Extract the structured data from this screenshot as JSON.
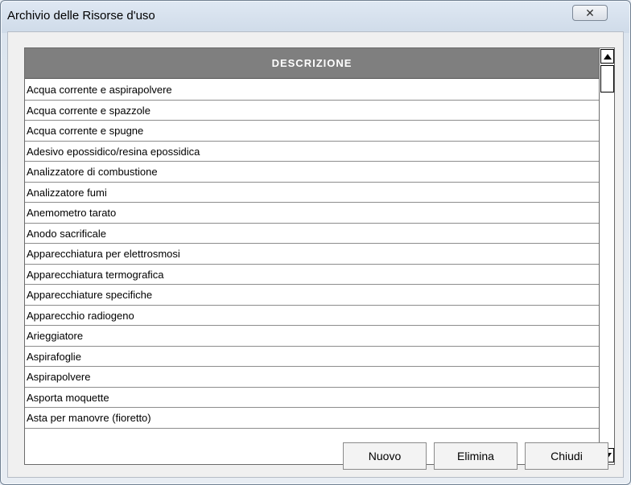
{
  "window": {
    "title": "Archivio delle Risorse d'uso",
    "close_glyph": "✕"
  },
  "grid": {
    "column_header": "DESCRIZIONE",
    "rows": [
      "Acqua corrente e aspirapolvere",
      "Acqua corrente e spazzole",
      "Acqua corrente e spugne",
      "Adesivo epossidico/resina epossidica",
      "Analizzatore di combustione",
      "Analizzatore fumi",
      "Anemometro tarato",
      "Anodo sacrificale",
      "Apparecchiatura per elettrosmosi",
      "Apparecchiatura termografica",
      "Apparecchiature specifiche",
      "Apparecchio radiogeno",
      "Arieggiatore",
      "Aspirafoglie",
      "Aspirapolvere",
      "Asporta moquette",
      "Asta per manovre (fioretto)"
    ]
  },
  "buttons": {
    "new_label": "Nuovo",
    "delete_label": "Elimina",
    "close_label": "Chiudi"
  }
}
